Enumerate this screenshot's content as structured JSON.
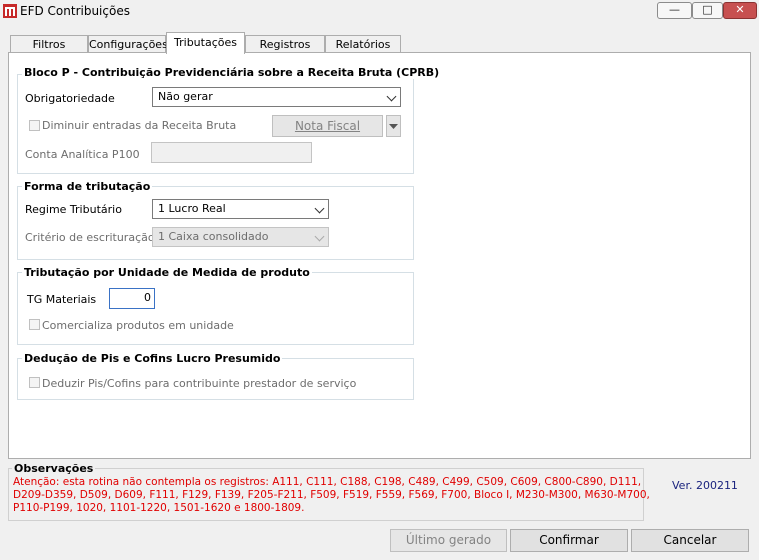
{
  "window": {
    "title": "EFD Contribuições"
  },
  "tabs": [
    "Filtros",
    "Configurações",
    "Tributações",
    "Registros",
    "Relatórios"
  ],
  "bloco_p": {
    "title": "Bloco P - Contribuição Previdenciária sobre a Receita Bruta (CPRB)",
    "obrigatoriedade_label": "Obrigatoriedade",
    "obrigatoriedade_value": "Não gerar",
    "diminuir_label": "Diminuir entradas da Receita Bruta",
    "nota_fiscal_label": "Nota Fiscal",
    "conta_label": "Conta Analítica P100",
    "conta_value": ""
  },
  "forma": {
    "title": "Forma de tributação",
    "regime_label": "Regime Tributário",
    "regime_value": "1 Lucro Real",
    "criterio_label": "Critério de escrituração",
    "criterio_value": "1 Caixa consolidado"
  },
  "unidade": {
    "title": "Tributação por Unidade de Medida de produto",
    "tg_label": "TG Materiais",
    "tg_value": "0",
    "comercializa_label": "Comercializa produtos em unidade"
  },
  "deducao": {
    "title": "Dedução de Pis e Cofins Lucro Presumido",
    "deduzir_label": "Deduzir Pis/Cofins para contribuinte prestador de serviço"
  },
  "observacoes": {
    "title": "Observações",
    "lines": [
      "Atenção: esta rotina não contempla os registros: A111, C111, C188, C198, C489, C499, C509, C609, C800-C890, D111,",
      "D209-D359, D509, D609, F111, F129, F139, F205-F211, F509, F519, F559, F569, F700, Bloco I, M230-M300, M630-M700,",
      "P110-P199, 1020, 1101-1220, 1501-1620 e 1800-1809."
    ]
  },
  "version": "Ver. 200211",
  "buttons": {
    "ultimo": "Último gerado",
    "confirmar": "Confirmar",
    "cancelar": "Cancelar"
  },
  "colors": {
    "warning_text": "#e00000",
    "version_text": "#1a237e",
    "focus_border": "#3a72c5"
  }
}
